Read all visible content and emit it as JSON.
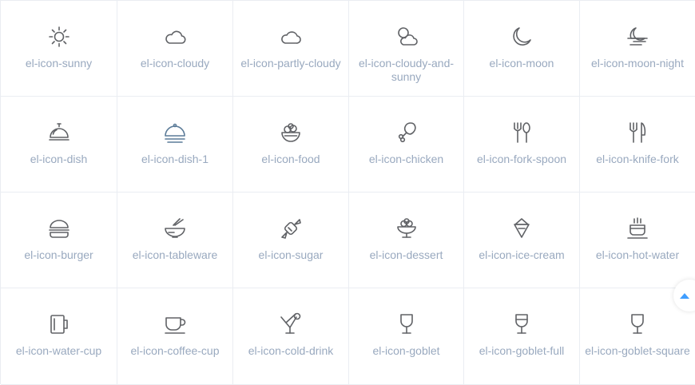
{
  "icons": [
    {
      "name": "el-icon-sunny",
      "icon": "sunny-icon"
    },
    {
      "name": "el-icon-cloudy",
      "icon": "cloudy-icon"
    },
    {
      "name": "el-icon-partly-cloudy",
      "icon": "partly-cloudy-icon"
    },
    {
      "name": "el-icon-cloudy-and-sunny",
      "icon": "cloudy-and-sunny-icon"
    },
    {
      "name": "el-icon-moon",
      "icon": "moon-icon"
    },
    {
      "name": "el-icon-moon-night",
      "icon": "moon-night-icon"
    },
    {
      "name": "el-icon-dish",
      "icon": "dish-icon"
    },
    {
      "name": "el-icon-dish-1",
      "icon": "dish-1-icon"
    },
    {
      "name": "el-icon-food",
      "icon": "food-icon"
    },
    {
      "name": "el-icon-chicken",
      "icon": "chicken-icon"
    },
    {
      "name": "el-icon-fork-spoon",
      "icon": "fork-spoon-icon"
    },
    {
      "name": "el-icon-knife-fork",
      "icon": "knife-fork-icon"
    },
    {
      "name": "el-icon-burger",
      "icon": "burger-icon"
    },
    {
      "name": "el-icon-tableware",
      "icon": "tableware-icon"
    },
    {
      "name": "el-icon-sugar",
      "icon": "sugar-icon"
    },
    {
      "name": "el-icon-dessert",
      "icon": "dessert-icon"
    },
    {
      "name": "el-icon-ice-cream",
      "icon": "ice-cream-icon"
    },
    {
      "name": "el-icon-hot-water",
      "icon": "hot-water-icon"
    },
    {
      "name": "el-icon-water-cup",
      "icon": "water-cup-icon"
    },
    {
      "name": "el-icon-coffee-cup",
      "icon": "coffee-cup-icon"
    },
    {
      "name": "el-icon-cold-drink",
      "icon": "cold-drink-icon"
    },
    {
      "name": "el-icon-goblet",
      "icon": "goblet-icon"
    },
    {
      "name": "el-icon-goblet-full",
      "icon": "goblet-full-icon"
    },
    {
      "name": "el-icon-goblet-square",
      "icon": "goblet-square-icon"
    }
  ],
  "colors": {
    "label": "#99a9bf",
    "icon": "#606266",
    "border": "#eaedf2",
    "accent": "#409eff"
  },
  "backtop": {
    "icon": "caret-top-icon"
  }
}
